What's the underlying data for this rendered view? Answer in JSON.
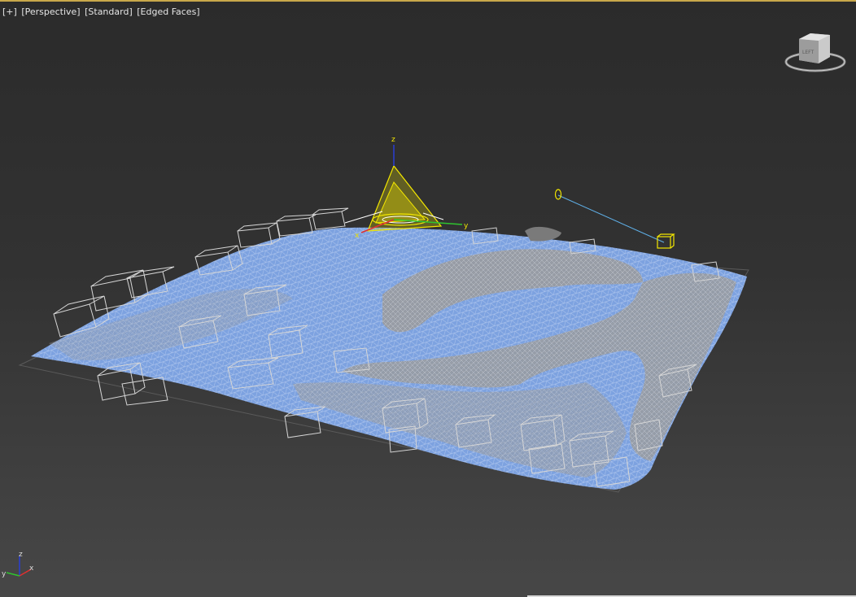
{
  "viewport": {
    "labels": {
      "plus": "[+]",
      "view": "[Perspective]",
      "shading": "[Standard]",
      "edges": "[Edged Faces]"
    },
    "viewcube": {
      "face_label": "LEFT",
      "icon": "viewcube-icon"
    },
    "gizmo": {
      "x_label": "x",
      "y_label": "y",
      "z_label": "z"
    },
    "tripod": {
      "x_label": "x",
      "y_label": "y",
      "z_label": "z"
    },
    "colors": {
      "terrain": "#7da2e0",
      "wire": "#d6d6d6",
      "selection": "#f2e600",
      "target_line": "#5fb0e8",
      "frame": "#c8a84a"
    }
  }
}
